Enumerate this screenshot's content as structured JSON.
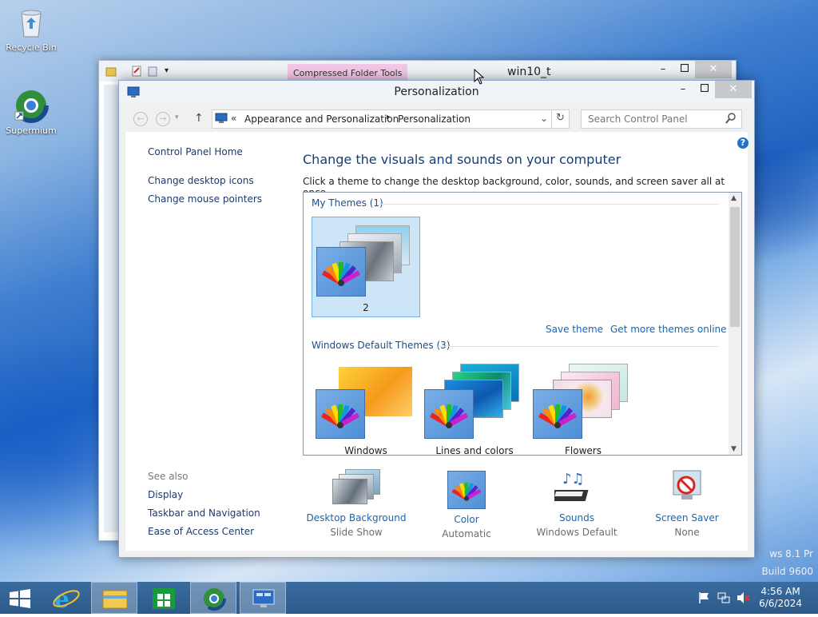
{
  "desktop": {
    "icons": [
      {
        "label": "Recycle Bin",
        "icon": "recycle-bin-icon"
      },
      {
        "label": "Supermium",
        "icon": "supermium-browser-icon"
      }
    ],
    "watermark_line1": "ws 8.1 Pr",
    "watermark_line2": "Build 9600"
  },
  "back_window": {
    "title": "win10_t",
    "context_tab": "Compressed Folder Tools",
    "tab_color": "#f2c7e6"
  },
  "window": {
    "title": "Personalization",
    "address": {
      "chevron": "«",
      "crumbs": [
        "Appearance and Personalization",
        "Personalization"
      ]
    },
    "search_placeholder": "Search Control Panel",
    "sidebar": {
      "home": "Control Panel Home",
      "links": [
        "Change desktop icons",
        "Change mouse pointers"
      ],
      "see_also_label": "See also",
      "see_also": [
        "Display",
        "Taskbar and Navigation",
        "Ease of Access Center"
      ]
    },
    "main": {
      "heading": "Change the visuals and sounds on your computer",
      "subtext": "Click a theme to change the desktop background, color, sounds, and screen saver all at once.",
      "my_themes_label": "My Themes (1)",
      "my_themes": [
        {
          "name": "2",
          "selected": true
        }
      ],
      "save_theme": "Save theme",
      "get_more": "Get more themes online",
      "default_label": "Windows Default Themes (3)",
      "default_themes": [
        {
          "name": "Windows"
        },
        {
          "name": "Lines and colors"
        },
        {
          "name": "Flowers"
        }
      ]
    },
    "bottom": [
      {
        "title": "Desktop Background",
        "sub": "Slide Show",
        "icon": "desktop-background-icon"
      },
      {
        "title": "Color",
        "sub": "Automatic",
        "icon": "color-palette-icon"
      },
      {
        "title": "Sounds",
        "sub": "Windows Default",
        "icon": "sounds-icon"
      },
      {
        "title": "Screen Saver",
        "sub": "None",
        "icon": "screen-saver-icon"
      }
    ]
  },
  "taskbar": {
    "items": [
      "start-button",
      "internet-explorer",
      "file-explorer",
      "store",
      "supermium",
      "control-panel"
    ],
    "time": "4:56 AM",
    "date": "6/6/2024"
  },
  "colors": {
    "link": "#1566b5",
    "section_heading": "#1b4e8c",
    "selected_theme_bg": "#cde6f7",
    "taskbar": "#2f5f90"
  }
}
